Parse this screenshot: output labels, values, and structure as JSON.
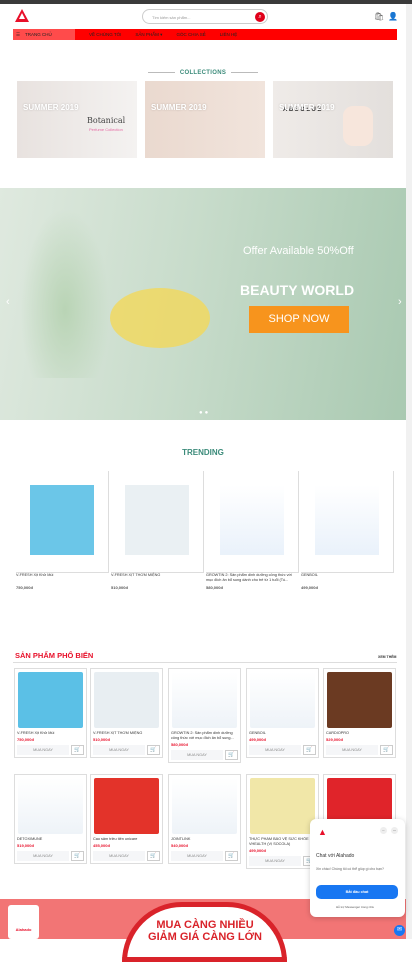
{
  "header": {
    "search_placeholder": "Tìm kiếm sản phẩm...",
    "search_icon": "search-icon"
  },
  "nav": {
    "items": [
      "TRANG CHỦ",
      "VỀ CHÚNG TÔI",
      "SẢN PHẨM ▾",
      "GÓC CHIA SẺ",
      "LIÊN HỆ"
    ]
  },
  "collections": {
    "title": "COLLECTIONS",
    "cards": [
      {
        "label": "SUMMER 2019"
      },
      {
        "label": "SUMMER 2019"
      },
      {
        "label": "SUMMER 2019"
      }
    ],
    "card1_brand": "Botanical",
    "card1_sub": "Perfume Collection",
    "card3_brand": "ABSOLUE"
  },
  "hero": {
    "offer": "Offer Available 50%Off",
    "headline": "BEAUTY WORLD",
    "cta": "SHOP NOW",
    "prev": "‹",
    "next": "›",
    "dots": "●●"
  },
  "trending": {
    "title": "TRENDING",
    "items": [
      {
        "name": "V-FRESH Xịt Khử Mùi",
        "price": "750,000đ"
      },
      {
        "name": "V-FRESH XỊT THƠM MIỆNG",
        "price": "510,000đ"
      },
      {
        "name": "GROWTIN 2: Sản phẩm dinh dưỡng công thức với mục đích ăn bổ sung dành cho trẻ từ 1 tuổi (Tú...",
        "price": "580,000đ"
      },
      {
        "name": "GENBOIL",
        "price": "499,000đ"
      }
    ]
  },
  "popular": {
    "title": "SẢN PHẨM PHỔ BIẾN",
    "more": "XEM THÊM",
    "buy_label": "MUA NGAY",
    "items": [
      {
        "name": "V-FRESH Xịt Khử Mùi",
        "price": "750,000đ"
      },
      {
        "name": "V-FRESH XỊT THƠM MIỆNG",
        "price": "510,000đ"
      },
      {
        "name": "GROWTIN 2: Sản phẩm dinh dưỡng công thức với mục đích ăn bổ sung...",
        "price": "580,000đ"
      },
      {
        "name": "GENBOIL",
        "price": "499,000đ"
      },
      {
        "name": "CARDIOPRO",
        "price": "529,000đ"
      },
      {
        "name": "DETOXIMUNE",
        "price": "519,000đ"
      },
      {
        "name": "Cao sâm triều tiên unicare",
        "price": "455,000đ"
      },
      {
        "name": "JOINTLINK",
        "price": "540,000đ"
      },
      {
        "name": "THỰC PHẨM BẢO VỆ SỨC KHỎE VHEALTH (VỊ SOCOLA)",
        "price": "499,000đ"
      }
    ]
  },
  "chat": {
    "title": "Chat với Alahado",
    "subtitle": "Xin chào! Chúng tôi có thể giúp gì cho bạn?",
    "button": "Bắt đầu chat",
    "footer": "Hỗ trợ Messenger trong nhà"
  },
  "banner": {
    "line1": "MUA CÀNG NHIỀU",
    "line2": "GIẢM GIÁ CÀNG LỚN",
    "logo_text": "Alahado"
  },
  "colors": {
    "brand_red": "#ff0000",
    "accent_teal": "#3b8b7a",
    "cta_orange": "#f7941d",
    "messenger_blue": "#1877f2"
  }
}
